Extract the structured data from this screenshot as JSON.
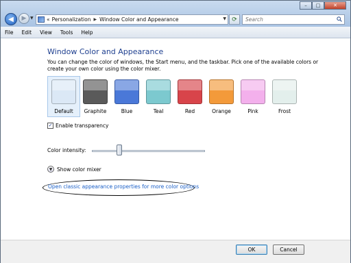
{
  "address": {
    "prefix": "«",
    "crumbs": [
      "Personalization",
      "Window Color and Appearance"
    ]
  },
  "search": {
    "placeholder": "Search"
  },
  "menu": [
    "File",
    "Edit",
    "View",
    "Tools",
    "Help"
  ],
  "page": {
    "title": "Window Color and Appearance",
    "description": "You can change the color of windows, the Start menu, and the taskbar. Pick one of the available colors or create your own color using the color mixer."
  },
  "colors": [
    {
      "label": "Default",
      "hex": "#dbe8f6",
      "selected": true
    },
    {
      "label": "Graphite",
      "hex": "#5a5a5a",
      "selected": false
    },
    {
      "label": "Blue",
      "hex": "#4a78d8",
      "selected": false
    },
    {
      "label": "Teal",
      "hex": "#7cc9cf",
      "selected": false
    },
    {
      "label": "Red",
      "hex": "#d8444a",
      "selected": false
    },
    {
      "label": "Orange",
      "hex": "#f39a3a",
      "selected": false
    },
    {
      "label": "Pink",
      "hex": "#f3b0ec",
      "selected": false
    },
    {
      "label": "Frost",
      "hex": "#e3efec",
      "selected": false
    }
  ],
  "transparency": {
    "label": "Enable transparency",
    "checked": true
  },
  "intensity": {
    "label": "Color intensity:",
    "value_fraction": 0.24
  },
  "mixer": {
    "label": "Show color mixer"
  },
  "classic_link": "Open classic appearance properties for more color options",
  "buttons": {
    "ok": "OK",
    "cancel": "Cancel"
  },
  "caption": {
    "minimize": "–",
    "maximize": "□",
    "close": "✕"
  }
}
